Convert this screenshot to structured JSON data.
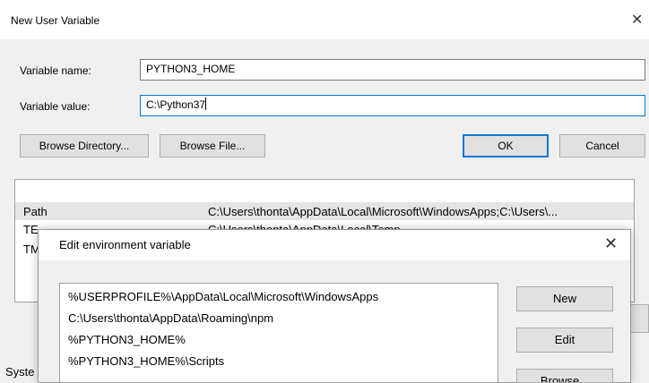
{
  "new_var_dialog": {
    "title": "New User Variable",
    "close_glyph": "✕",
    "name_label": "Variable name:",
    "name_value": "PYTHON3_HOME",
    "value_label": "Variable value:",
    "value_value": "C:\\Python37",
    "browse_dir_label": "Browse Directory...",
    "browse_file_label": "Browse File...",
    "ok_label": "OK",
    "cancel_label": "Cancel"
  },
  "background": {
    "rows": [
      {
        "name": "Path",
        "value": "C:\\Users\\thonta\\AppData\\Local\\Microsoft\\WindowsApps;C:\\Users\\..."
      },
      {
        "name": "TE",
        "value": "C:\\Users\\thonta\\AppData\\Local\\Temp"
      },
      {
        "name": "TM",
        "value": ""
      }
    ],
    "footer_label": "Syste"
  },
  "edit_dialog": {
    "title": "Edit environment variable",
    "close_glyph": "✕",
    "items": [
      "%USERPROFILE%\\AppData\\Local\\Microsoft\\WindowsApps",
      "C:\\Users\\thonta\\AppData\\Roaming\\npm",
      "%PYTHON3_HOME%",
      "%PYTHON3_HOME%\\Scripts"
    ],
    "new_label": "New",
    "edit_label": "Edit",
    "browse_label": "Browse..."
  }
}
